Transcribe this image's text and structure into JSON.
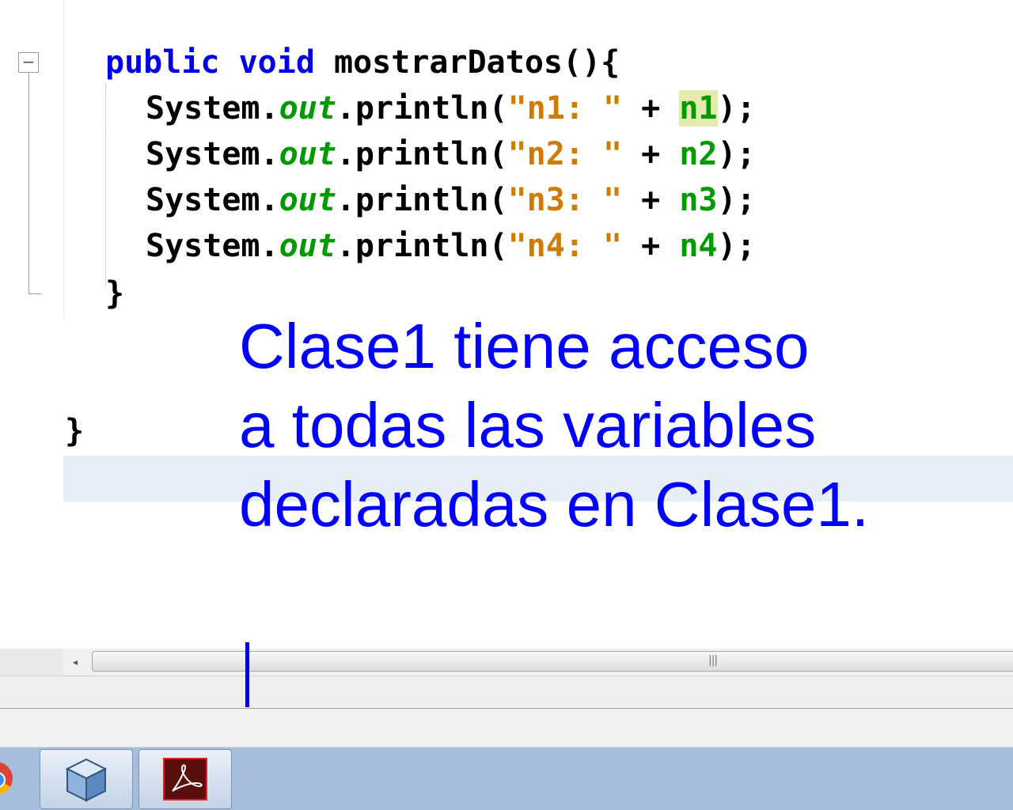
{
  "editor": {
    "lines": [
      {
        "parts": [
          {
            "t": "public",
            "c": "kw"
          },
          {
            "t": " "
          },
          {
            "t": "void",
            "c": "kw"
          },
          {
            "t": " mostrarDatos(){"
          }
        ]
      },
      {
        "parts": [
          {
            "t": "System."
          },
          {
            "t": "out",
            "c": "field"
          },
          {
            "t": ".println("
          },
          {
            "t": "\"n1: \"",
            "c": "str"
          },
          {
            "t": " + "
          },
          {
            "t": "n1",
            "c": "var hl"
          },
          {
            "t": ");"
          }
        ]
      },
      {
        "parts": [
          {
            "t": "System."
          },
          {
            "t": "out",
            "c": "field"
          },
          {
            "t": ".println("
          },
          {
            "t": "\"n2: \"",
            "c": "str"
          },
          {
            "t": " + "
          },
          {
            "t": "n2",
            "c": "var"
          },
          {
            "t": ");"
          }
        ]
      },
      {
        "parts": [
          {
            "t": "System."
          },
          {
            "t": "out",
            "c": "field"
          },
          {
            "t": ".println("
          },
          {
            "t": "\"n3: \"",
            "c": "str"
          },
          {
            "t": " + "
          },
          {
            "t": "n3",
            "c": "var"
          },
          {
            "t": ");"
          }
        ]
      },
      {
        "parts": [
          {
            "t": "System."
          },
          {
            "t": "out",
            "c": "field"
          },
          {
            "t": ".println("
          },
          {
            "t": "\"n4: \"",
            "c": "str"
          },
          {
            "t": " + "
          },
          {
            "t": "n4",
            "c": "var"
          },
          {
            "t": ");"
          }
        ]
      },
      {
        "parts": [
          {
            "t": "}"
          }
        ]
      },
      {
        "parts": [
          {
            "t": "}"
          }
        ]
      }
    ],
    "fold_symbol": "−",
    "syntax_colors": {
      "keyword": "#0000e6",
      "field": "#009900",
      "string": "#ce7b00",
      "variable": "#009900",
      "highlight": "#e4eab0"
    }
  },
  "annotation": {
    "lines": [
      "Clase1 tiene acceso",
      "a todas las variables",
      "declaradas en Clase1."
    ],
    "color": "#0000ff"
  },
  "scrollbar": {
    "left_arrow": "◂",
    "grip": "|||"
  },
  "taskbar": {
    "items": [
      {
        "icon": "chrome-icon"
      },
      {
        "icon": "netbeans-icon"
      },
      {
        "icon": "acrobat-icon"
      }
    ]
  }
}
